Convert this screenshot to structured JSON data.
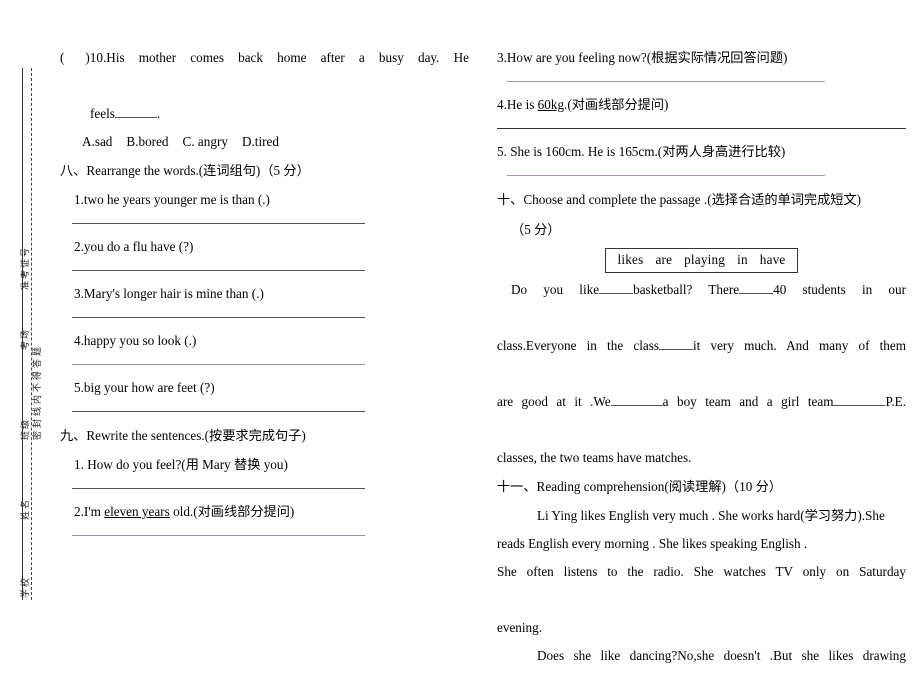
{
  "binding": {
    "outer_labels": [
      "准考证号",
      "考场",
      "班级",
      "姓名",
      "学校"
    ],
    "inner_label": "密封线内不得答题"
  },
  "left_column": {
    "q10": {
      "prefix": "(",
      "number": ")10.",
      "text": "His  mother  comes  back  home  after  a  busy  day.  He",
      "text2": "feels",
      "period": ".",
      "options": [
        "A.sad",
        "B.bored",
        "C. angry",
        "D.tired"
      ]
    },
    "section8": {
      "heading": "八、Rearrange the words.(连词组句)（5 分）",
      "items": [
        "1.two   he   years   younger   me   is   than (.)",
        "2.you   do   a   flu   have   (?)",
        "3.Mary's   longer   hair   is   mine   than   (.)",
        "4.happy   you   so   look   (.)",
        "5.big   your   how   are   feet   (?)"
      ]
    },
    "section9": {
      "heading": "九、Rewrite the sentences.(按要求完成句子)",
      "item1": "1. How do you feel?(用 Mary  替换  you)",
      "item2_pre": "2.I'm ",
      "item2_underlined": "eleven years",
      "item2_post": " old.(对画线部分提问)"
    }
  },
  "right_column": {
    "q3": "3.How are you feeling now?(根据实际情况回答问题)",
    "q4_pre": "4.He is ",
    "q4_underlined": "60kg",
    "q4_post": ".(对画线部分提问)",
    "q5": "5. She is 160cm. He is 165cm.(对两人身高进行比较)",
    "section10": {
      "heading": "十、Choose and complete the passage .(选择合适的单词完成短文)",
      "points": "（5 分）",
      "word_bank": [
        "likes",
        "are",
        "playing",
        "in",
        "have"
      ],
      "passage_l1a": "Do  you  like",
      "passage_l1b": "basketball?  There",
      "passage_l1c": "40  students  in  our",
      "passage_l2a": "class.Everyone  in  the  class",
      "passage_l2b": "it  very  much.  And  many  of  them",
      "passage_l3a": "are good at it .We",
      "passage_l3b": "a boy team and a girl team",
      "passage_l3c": "P.E.",
      "passage_l4": "classes, the two teams have matches."
    },
    "section11": {
      "heading": "十一、Reading comprehension(阅读理解)（10 分）",
      "p1_l1": "Li Ying likes English very much . She works hard(学习努力).She",
      "p1_l2": "reads English every morning . She likes speaking English .",
      "p1_l3": "She often listens to the radio. She watches TV only on Saturday",
      "p1_l4": "evening.",
      "p2_l1": "Does she like dancing?No,she doesn't .But she likes drawing"
    }
  }
}
